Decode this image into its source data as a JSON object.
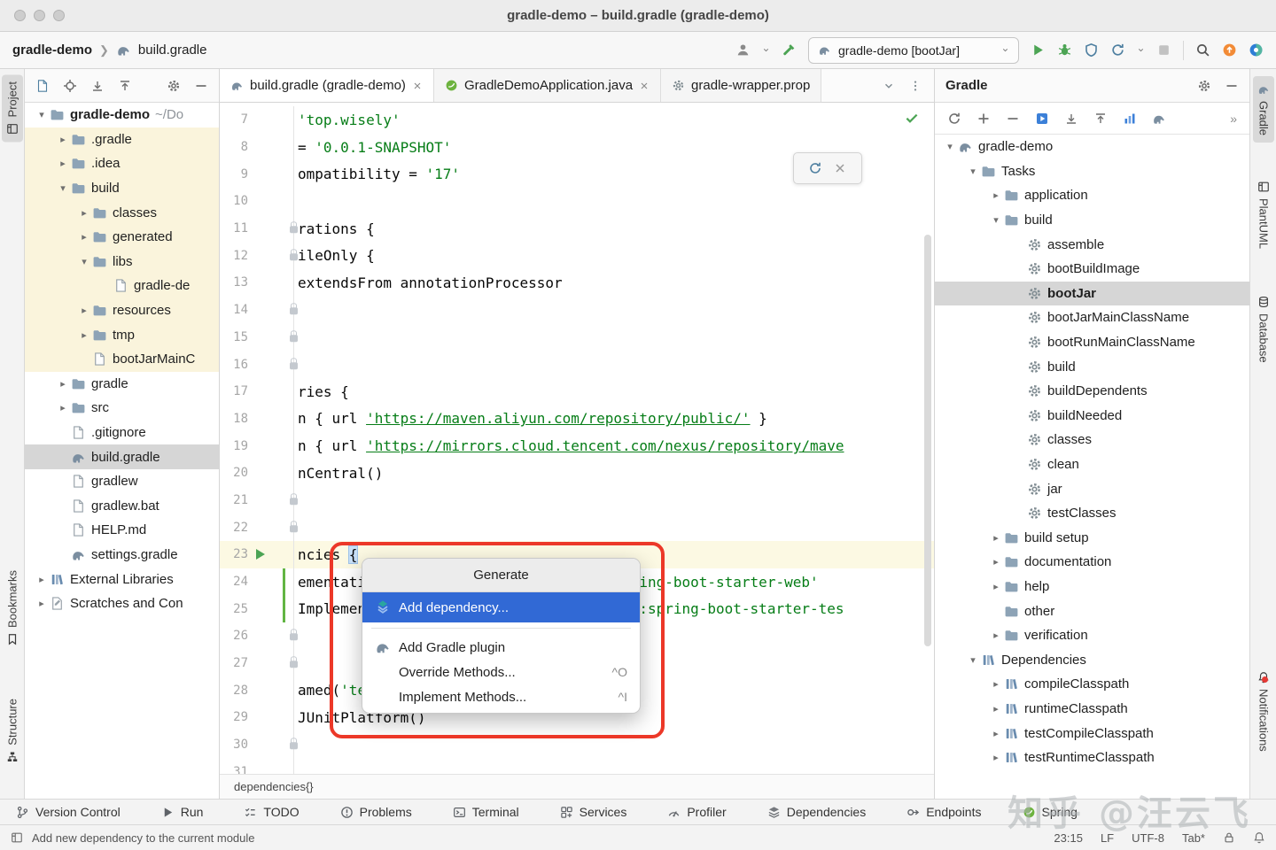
{
  "window": {
    "title": "gradle-demo – build.gradle (gradle-demo)"
  },
  "navbar": {
    "project": "gradle-demo",
    "file": "build.gradle",
    "run_config": "gradle-demo [bootJar]"
  },
  "left_strip": {
    "items": [
      "Project",
      "Bookmarks",
      "Structure"
    ]
  },
  "right_strip": {
    "items": [
      "Gradle",
      "PlantUML",
      "Database",
      "Notifications"
    ]
  },
  "project": {
    "items": [
      {
        "label": "gradle-demo",
        "suffix": "~/Do",
        "indent": 0,
        "chevron": "down",
        "icon": "folder",
        "bold": true
      },
      {
        "label": ".gradle",
        "indent": 1,
        "chevron": "right",
        "icon": "folder",
        "excluded": true
      },
      {
        "label": ".idea",
        "indent": 1,
        "chevron": "right",
        "icon": "folder",
        "excluded": true
      },
      {
        "label": "build",
        "indent": 1,
        "chevron": "down",
        "icon": "folder",
        "excluded": true
      },
      {
        "label": "classes",
        "indent": 2,
        "chevron": "right",
        "icon": "folder",
        "excluded": true
      },
      {
        "label": "generated",
        "indent": 2,
        "chevron": "right",
        "icon": "folder",
        "excluded": true
      },
      {
        "label": "libs",
        "indent": 2,
        "chevron": "down",
        "icon": "folder",
        "excluded": true
      },
      {
        "label": "gradle-de",
        "indent": 3,
        "icon": "file",
        "excluded": true
      },
      {
        "label": "resources",
        "indent": 2,
        "chevron": "right",
        "icon": "folder",
        "excluded": true
      },
      {
        "label": "tmp",
        "indent": 2,
        "chevron": "right",
        "icon": "folder",
        "excluded": true
      },
      {
        "label": "bootJarMainC",
        "indent": 2,
        "icon": "file",
        "excluded": true
      },
      {
        "label": "gradle",
        "indent": 1,
        "chevron": "right",
        "icon": "folder"
      },
      {
        "label": "src",
        "indent": 1,
        "chevron": "right",
        "icon": "folder"
      },
      {
        "label": ".gitignore",
        "indent": 1,
        "icon": "file"
      },
      {
        "label": "build.gradle",
        "indent": 1,
        "icon": "gradle",
        "selected": true
      },
      {
        "label": "gradlew",
        "indent": 1,
        "icon": "file"
      },
      {
        "label": "gradlew.bat",
        "indent": 1,
        "icon": "file"
      },
      {
        "label": "HELP.md",
        "indent": 1,
        "icon": "file"
      },
      {
        "label": "settings.gradle",
        "indent": 1,
        "icon": "gradle"
      },
      {
        "label": "External Libraries",
        "indent": 0,
        "chevron": "right",
        "icon": "lib"
      },
      {
        "label": "Scratches and Con",
        "indent": 0,
        "chevron": "right",
        "icon": "scratch"
      }
    ]
  },
  "tabs": {
    "items": [
      {
        "label": "build.gradle (gradle-demo)"
      },
      {
        "label": "GradleDemoApplication.java"
      },
      {
        "label": "gradle-wrapper.prop"
      }
    ]
  },
  "editor": {
    "breadcrumb": "dependencies{}",
    "lines": [
      {
        "num": 7,
        "parts": [
          {
            "t": "'top.wisely'",
            "s": "str"
          }
        ]
      },
      {
        "num": 8,
        "parts": [
          {
            "t": "= ",
            "s": "d"
          },
          {
            "t": "'0.0.1-SNAPSHOT'",
            "s": "str"
          }
        ]
      },
      {
        "num": 9,
        "parts": [
          {
            "t": "ompatibility = ",
            "s": "d"
          },
          {
            "t": "'17'",
            "s": "str"
          }
        ]
      },
      {
        "num": 10,
        "parts": []
      },
      {
        "num": 11,
        "parts": [
          {
            "t": "rations {",
            "s": "d"
          }
        ],
        "lock": true
      },
      {
        "num": 12,
        "parts": [
          {
            "t": "ileOnly {",
            "s": "d"
          }
        ],
        "lock": true
      },
      {
        "num": 13,
        "parts": [
          {
            "t": "extendsFrom annotationProcessor",
            "s": "d"
          }
        ]
      },
      {
        "num": 14,
        "parts": [],
        "lock": true
      },
      {
        "num": 15,
        "parts": [],
        "lock": true
      },
      {
        "num": 16,
        "parts": [],
        "lock": true
      },
      {
        "num": 17,
        "parts": [
          {
            "t": "ries {",
            "s": "d"
          }
        ]
      },
      {
        "num": 18,
        "parts": [
          {
            "t": "n { url ",
            "s": "d"
          },
          {
            "t": "'https://maven.aliyun.com/repository/public/'",
            "s": "url"
          },
          {
            "t": " }",
            "s": "d"
          }
        ]
      },
      {
        "num": 19,
        "parts": [
          {
            "t": "n { url ",
            "s": "d"
          },
          {
            "t": "'https://mirrors.cloud.tencent.com/nexus/repository/mave",
            "s": "url"
          }
        ]
      },
      {
        "num": 20,
        "parts": [
          {
            "t": "nCentral()",
            "s": "d"
          }
        ]
      },
      {
        "num": 21,
        "parts": [],
        "lock": true
      },
      {
        "num": 22,
        "parts": [],
        "lock": true
      },
      {
        "num": 23,
        "parts": [
          {
            "t": "ncies ",
            "s": "d"
          },
          {
            "t": "{",
            "s": "brace"
          }
        ],
        "cur": true,
        "run": true
      },
      {
        "num": 24,
        "parts": [
          {
            "t": "ementation ",
            "s": "d"
          },
          {
            "t": "'org.springframework.boot:spring-boot-starter-web'",
            "s": "str"
          }
        ],
        "change": true
      },
      {
        "num": 25,
        "parts": [
          {
            "t": "Implementation ",
            "s": "d"
          },
          {
            "t": "'org.springframework.boot:spring-boot-starter-tes",
            "s": "str"
          }
        ],
        "change": true
      },
      {
        "num": 26,
        "parts": [],
        "lock": true
      },
      {
        "num": 27,
        "parts": [],
        "lock": true
      },
      {
        "num": 28,
        "parts": [
          {
            "t": "amed(",
            "s": "d"
          },
          {
            "t": "'test'",
            "s": "str"
          },
          {
            "t": ") {",
            "s": "d"
          }
        ]
      },
      {
        "num": 29,
        "parts": [
          {
            "t": "JUnitPlatform()",
            "s": "d"
          }
        ]
      },
      {
        "num": 30,
        "parts": [],
        "lock": true
      },
      {
        "num": 31,
        "parts": []
      }
    ]
  },
  "popup": {
    "title": "Generate",
    "items": [
      {
        "label": "Add dependency...",
        "shortcut": ""
      },
      {
        "label": "Add Gradle plugin",
        "shortcut": ""
      },
      {
        "label": "Override Methods...",
        "shortcut": "^O"
      },
      {
        "label": "Implement Methods...",
        "shortcut": "^I"
      }
    ]
  },
  "gradle_panel": {
    "title": "Gradle",
    "items": [
      {
        "label": "gradle-demo",
        "indent": 0,
        "chevron": "down",
        "icon": "gradle"
      },
      {
        "label": "Tasks",
        "indent": 1,
        "chevron": "down",
        "icon": "folder"
      },
      {
        "label": "application",
        "indent": 2,
        "chevron": "right",
        "icon": "folder"
      },
      {
        "label": "build",
        "indent": 2,
        "chevron": "down",
        "icon": "folder"
      },
      {
        "label": "assemble",
        "indent": 3,
        "icon": "gear"
      },
      {
        "label": "bootBuildImage",
        "indent": 3,
        "icon": "gear"
      },
      {
        "label": "bootJar",
        "indent": 3,
        "icon": "gear",
        "selected": true,
        "bold": true
      },
      {
        "label": "bootJarMainClassName",
        "indent": 3,
        "icon": "gear"
      },
      {
        "label": "bootRunMainClassName",
        "indent": 3,
        "icon": "gear"
      },
      {
        "label": "build",
        "indent": 3,
        "icon": "gear"
      },
      {
        "label": "buildDependents",
        "indent": 3,
        "icon": "gear"
      },
      {
        "label": "buildNeeded",
        "indent": 3,
        "icon": "gear"
      },
      {
        "label": "classes",
        "indent": 3,
        "icon": "gear"
      },
      {
        "label": "clean",
        "indent": 3,
        "icon": "gear"
      },
      {
        "label": "jar",
        "indent": 3,
        "icon": "gear"
      },
      {
        "label": "testClasses",
        "indent": 3,
        "icon": "gear"
      },
      {
        "label": "build setup",
        "indent": 2,
        "chevron": "right",
        "icon": "folder"
      },
      {
        "label": "documentation",
        "indent": 2,
        "chevron": "right",
        "icon": "folder"
      },
      {
        "label": "help",
        "indent": 2,
        "chevron": "right",
        "icon": "folder"
      },
      {
        "label": "other",
        "indent": 2,
        "ch evron": "right",
        "icon": "folder"
      },
      {
        "label": "verification",
        "indent": 2,
        "chevron": "right",
        "icon": "folder"
      },
      {
        "label": "Dependencies",
        "indent": 1,
        "chevron": "down",
        "icon": "lib"
      },
      {
        "label": "compileClasspath",
        "indent": 2,
        "chevron": "right",
        "icon": "lib"
      },
      {
        "label": "runtimeClasspath",
        "indent": 2,
        "chevron": "right",
        "icon": "lib"
      },
      {
        "label": "testCompileClasspath",
        "indent": 2,
        "chevron": "right",
        "icon": "lib"
      },
      {
        "label": "testRuntimeClasspath",
        "indent": 2,
        "chevron": "right",
        "icon": "lib"
      }
    ]
  },
  "bottom_bar": {
    "items": [
      {
        "label": "Version Control"
      },
      {
        "label": "Run"
      },
      {
        "label": "TODO"
      },
      {
        "label": "Problems"
      },
      {
        "label": "Terminal"
      },
      {
        "label": "Services"
      },
      {
        "label": "Profiler"
      },
      {
        "label": "Dependencies"
      },
      {
        "label": "Endpoints"
      },
      {
        "label": "Spring"
      }
    ]
  },
  "status_bar": {
    "message": "Add new dependency to the current module",
    "time": "23:15",
    "line_ending": "LF",
    "encoding": "UTF-8",
    "indent_info": "Tab*"
  },
  "watermark": "知乎 @汪云飞",
  "colors": {
    "selection_blue": "#3169D5",
    "string_green": "#067D17",
    "excluded_yellow": "#FAF4DC",
    "annotation_red": "#EC3828",
    "run_green": "#4CA454",
    "spring_green": "#6DB33F",
    "update_orange": "#F28B36"
  }
}
